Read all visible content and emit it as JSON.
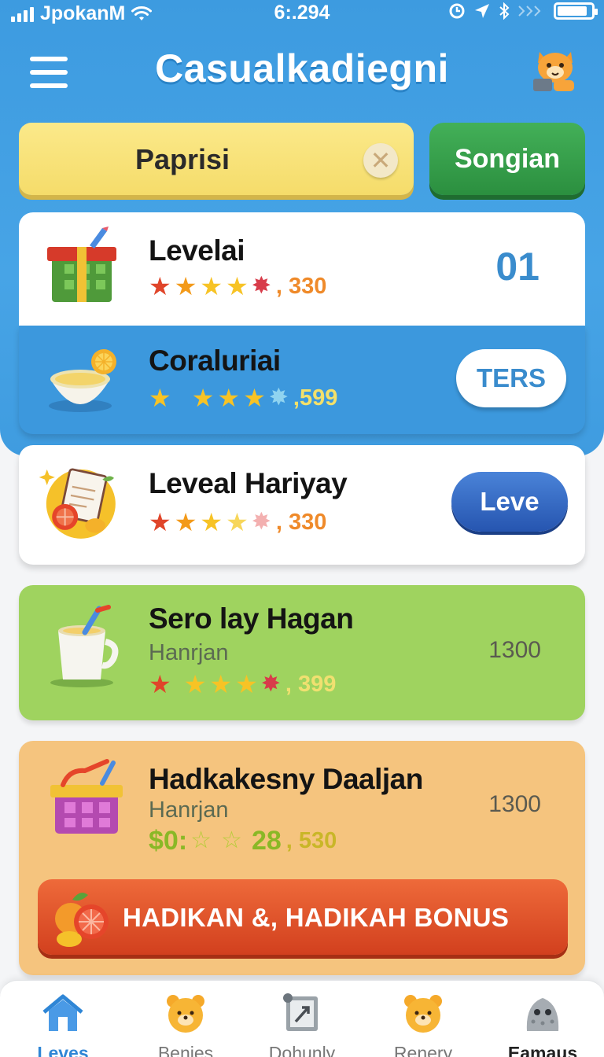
{
  "status_bar": {
    "carrier": "JpokanM",
    "time": "6:.294"
  },
  "header": {
    "title": "Casualkadiegni"
  },
  "search": {
    "value": "Paprisi",
    "action_label": "Songian"
  },
  "levels": [
    {
      "title": "Levelai",
      "stars": 4,
      "score": ", 330",
      "badge": "01",
      "bg": "#ffffff"
    },
    {
      "title": "Coraluriai",
      "stars": 4,
      "score": ",599",
      "button": "TERS",
      "bg": "#3c98dd"
    },
    {
      "title": "Leveal Hariyay",
      "stars": 4,
      "score": ", 330",
      "button": "Leve",
      "bg": "#ffffff"
    },
    {
      "title": "Sero lay Hagan",
      "subtitle": "Hanrjan",
      "stars": 4,
      "score": ", 399",
      "side_value": "1300",
      "bg": "#9fd35f"
    },
    {
      "title": "Hadkakesny Daaljan",
      "subtitle": "Hanrjan",
      "reward_prefix": "$0:",
      "reward_value": "28",
      "score": ", 530",
      "side_value": "1300",
      "bg": "#f5c47e",
      "bonus_label": "HADIKAN &, HADIKAH BONUS"
    }
  ],
  "tabs": [
    {
      "label": "Leves",
      "icon": "house-icon",
      "active": true
    },
    {
      "label": "Benies",
      "icon": "bear-face-icon"
    },
    {
      "label": "Dohunly",
      "icon": "picture-frame-icon"
    },
    {
      "label": "Renery",
      "icon": "bear-face-icon"
    },
    {
      "label": "Eamaus",
      "icon": "monster-icon"
    }
  ],
  "colors": {
    "primary_blue": "#3d9be0",
    "accent_green": "#2b8f3f",
    "star_red": "#e0452a",
    "star_yellow": "#f7c325"
  }
}
